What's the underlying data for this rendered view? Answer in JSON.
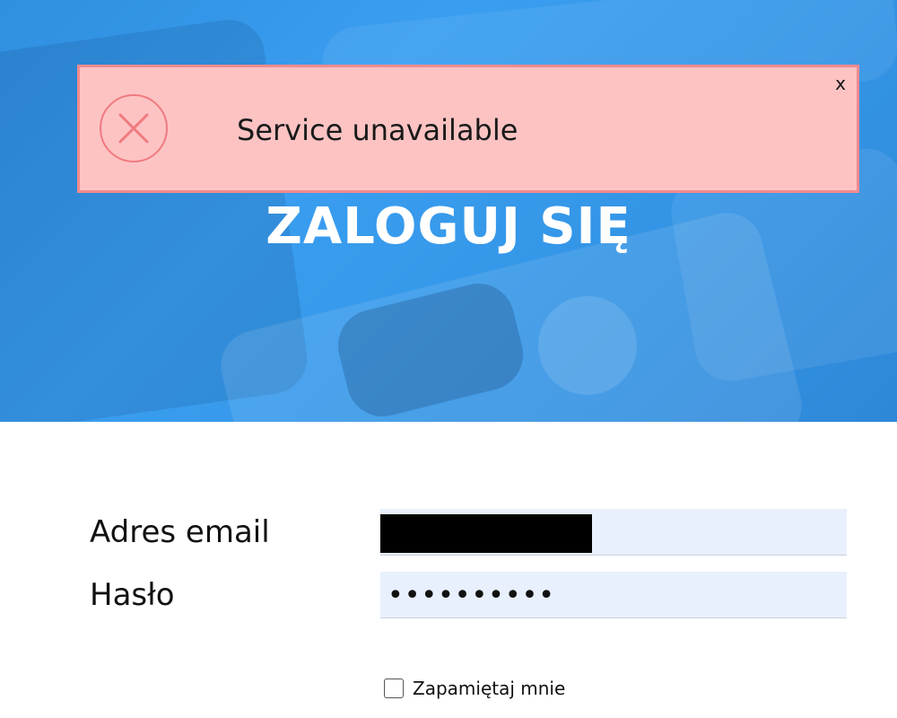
{
  "hero": {
    "title": "ZALOGUJ SIĘ",
    "background_color": "#3597e8"
  },
  "alert": {
    "icon": "error-x-circle-icon",
    "message": "Service unavailable",
    "close_label": "x",
    "background_color": "#fdc3c3",
    "border_color": "#f08a8f"
  },
  "form": {
    "email_label": "Adres email",
    "email_value": "",
    "email_redacted": true,
    "password_label": "Hasło",
    "password_masked": "••••••••••",
    "remember_label": "Zapamiętaj mnie",
    "remember_checked": false,
    "field_background": "#e8f0fe"
  }
}
